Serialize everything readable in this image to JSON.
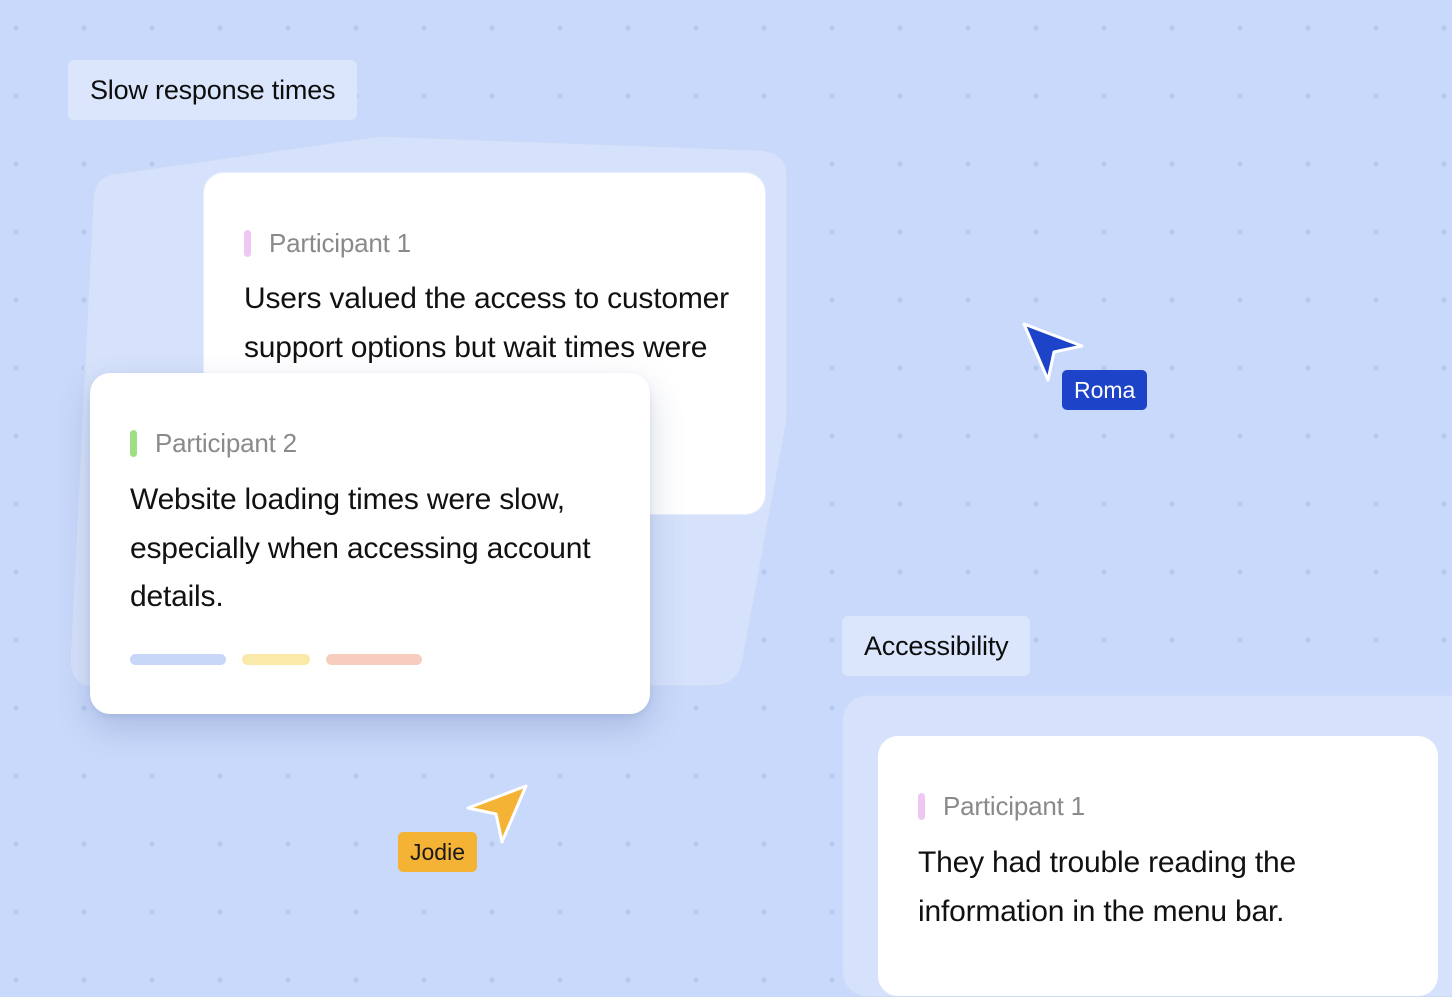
{
  "groups": {
    "slow": {
      "label": "Slow response times"
    },
    "accessibility": {
      "label": "Accessibility"
    }
  },
  "cards": {
    "slow_p1": {
      "participant": "Participant 1",
      "marker_color": "#eec8f3",
      "quote": "Users valued the access to customer support options but wait times were generally too slow."
    },
    "slow_p2": {
      "participant": "Participant 2",
      "marker_color": "#9ddf84",
      "quote": "Website loading times were slow, especially when accessing account details.",
      "tag_colors": [
        "#c8d6f7",
        "#fbe9a9",
        "#f6cdbf"
      ]
    },
    "access_p1": {
      "participant": "Participant 1",
      "marker_color": "#eec8f3",
      "quote": "They had trouble reading the information in the menu bar."
    }
  },
  "cursors": {
    "roma": {
      "name": "Roma",
      "color": "#1d44c8",
      "text_color": "#ffffff"
    },
    "jodie": {
      "name": "Jodie",
      "color": "#f5b335",
      "text_color": "#1a1a1a"
    }
  }
}
